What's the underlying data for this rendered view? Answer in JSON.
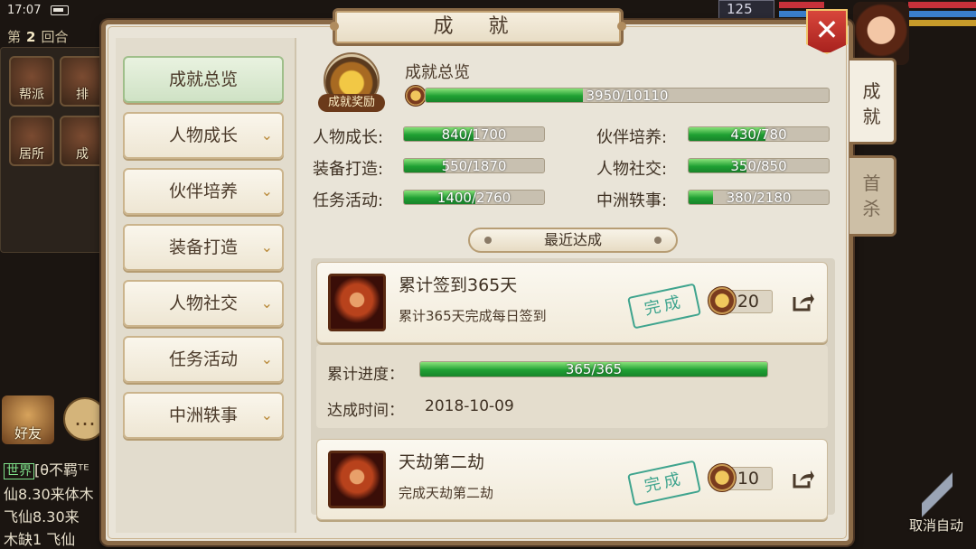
{
  "status": {
    "time": "17:07"
  },
  "hud": {
    "round_prefix": "第",
    "round_number": "2",
    "round_suffix": "回合",
    "counter": "125",
    "tiles": [
      "帮派",
      "排",
      "居所",
      "成"
    ],
    "friend_label": "好友",
    "cancel_auto_label": "取消自动",
    "chat_lines": [
      {
        "tag": "世界",
        "text": "[θ不羁ᵀᴱ"
      },
      {
        "text": "仙8.30来体木"
      },
      {
        "text": "  飞仙8.30来"
      },
      {
        "text": "木缺1   飞仙"
      }
    ]
  },
  "window": {
    "title": "成 就",
    "close_label": "✕",
    "side_tabs": [
      "成就",
      "首杀"
    ]
  },
  "nav": {
    "items": [
      {
        "label": "成就总览",
        "active": true
      },
      {
        "label": "人物成长"
      },
      {
        "label": "伙伴培养"
      },
      {
        "label": "装备打造"
      },
      {
        "label": "人物社交"
      },
      {
        "label": "任务活动"
      },
      {
        "label": "中洲轶事"
      }
    ],
    "chevron": "⌄"
  },
  "overview": {
    "chest_label": "成就奖励",
    "title": "成就总览",
    "total": {
      "current": 3950,
      "max": 10110,
      "text": "3950/10110"
    },
    "stats": [
      {
        "label": "人物成长:",
        "current": 840,
        "max": 1700,
        "text": "840/1700"
      },
      {
        "label": "伙伴培养:",
        "current": 430,
        "max": 780,
        "text": "430/780"
      },
      {
        "label": "装备打造:",
        "current": 550,
        "max": 1870,
        "text": "550/1870"
      },
      {
        "label": "人物社交:",
        "current": 350,
        "max": 850,
        "text": "350/850"
      },
      {
        "label": "任务活动:",
        "current": 1400,
        "max": 2760,
        "text": "1400/2760"
      },
      {
        "label": "中洲轶事:",
        "current": 380,
        "max": 2180,
        "text": "380/2180"
      }
    ]
  },
  "recent": {
    "heading": "最近达成",
    "items": [
      {
        "title": "累计签到365天",
        "desc": "累计365天完成每日签到",
        "status": "完成",
        "reward": "20"
      },
      {
        "title": "天劫第二劫",
        "desc": "完成天劫第二劫",
        "status": "完成",
        "reward": "10"
      }
    ],
    "detail": {
      "progress_label": "累计进度：",
      "progress": {
        "current": 365,
        "max": 365,
        "text": "365/365"
      },
      "time_label": "达成时间：",
      "time_value": "2018-10-09"
    }
  }
}
